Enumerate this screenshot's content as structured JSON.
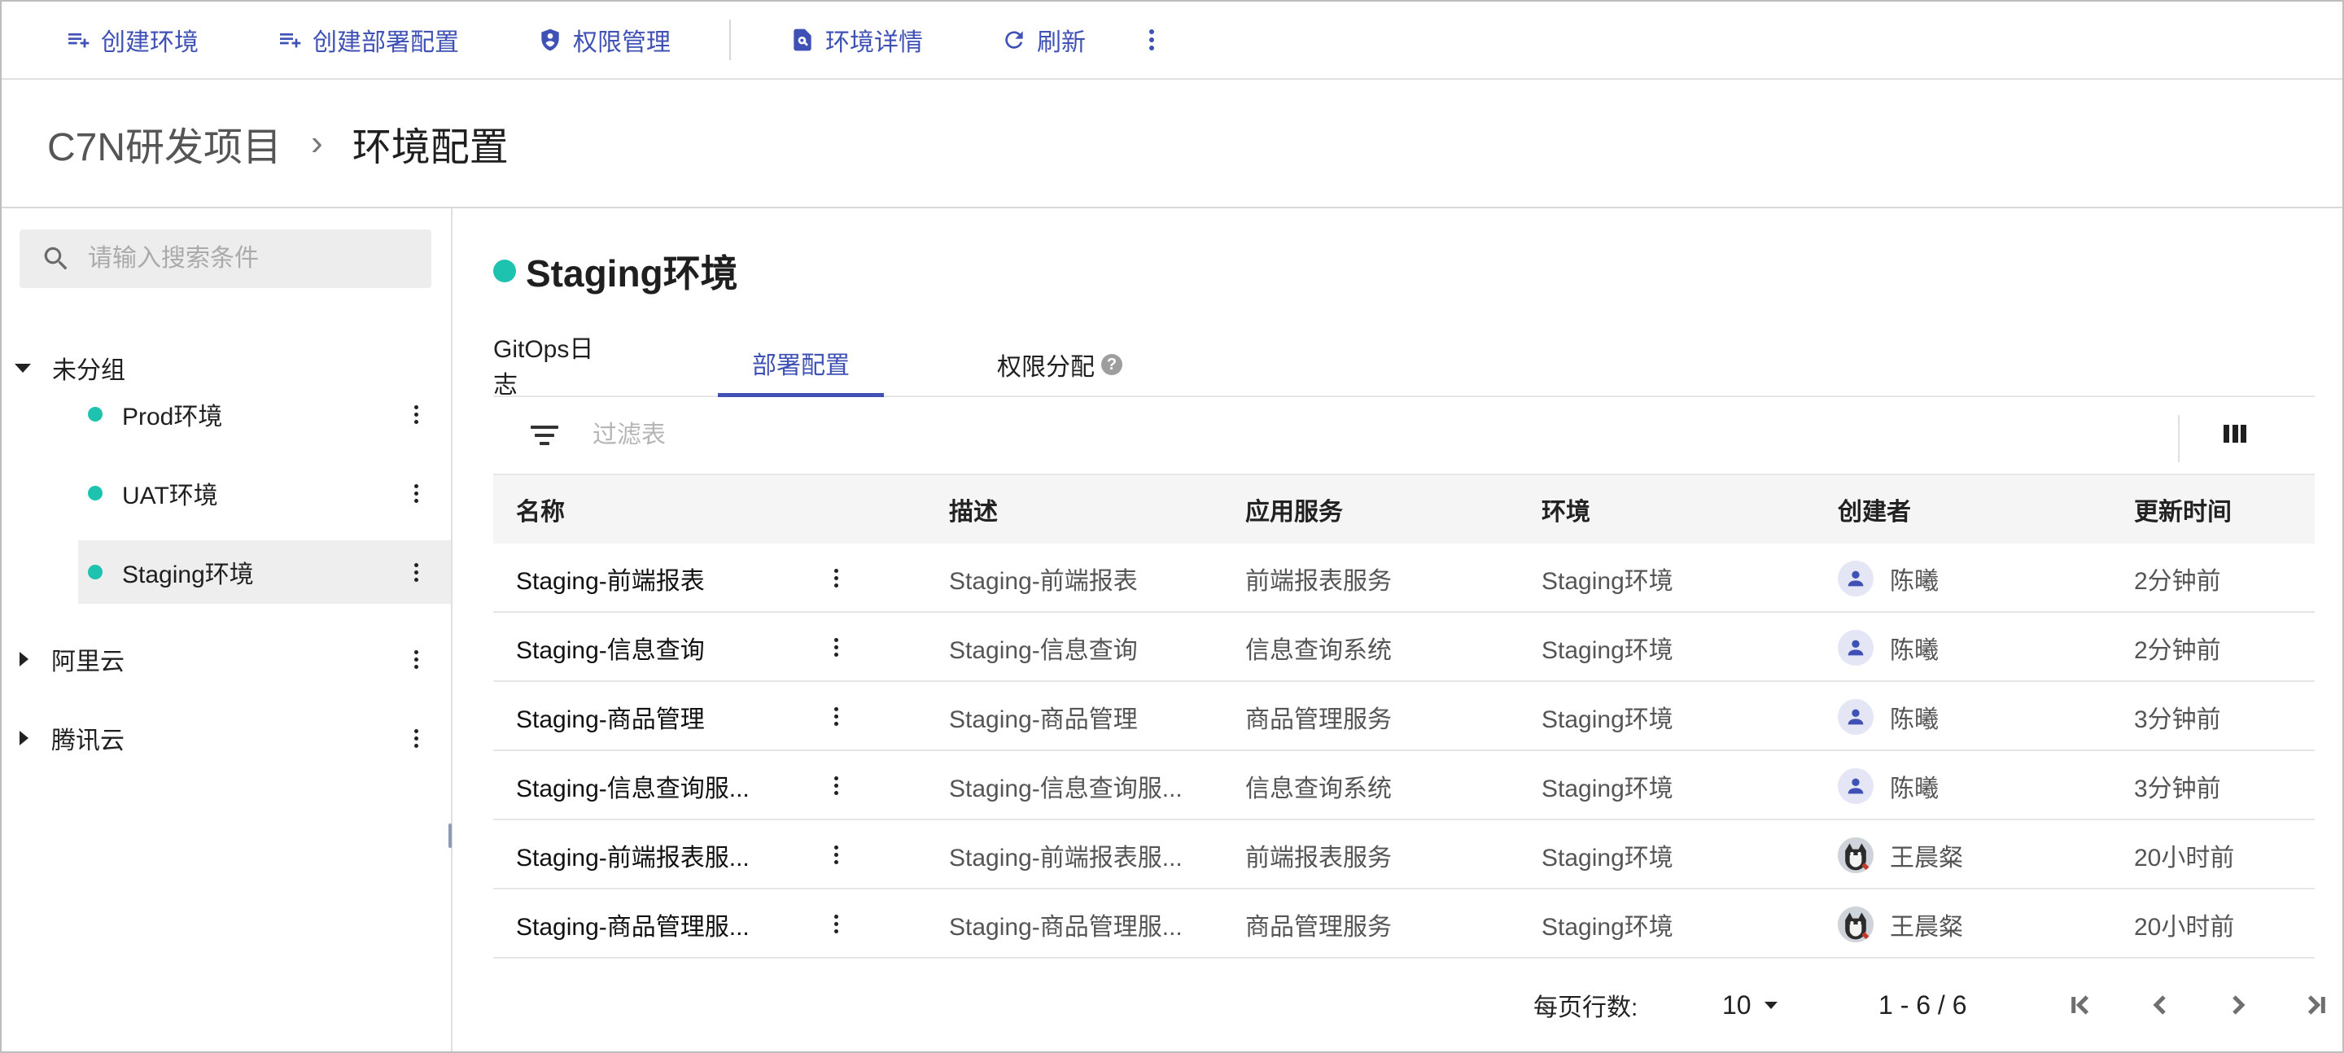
{
  "toolbar": {
    "create_env": "创建环境",
    "create_deploy_config": "创建部署配置",
    "permission_mgmt": "权限管理",
    "env_detail": "环境详情",
    "refresh": "刷新"
  },
  "breadcrumb": {
    "parent": "C7N研发项目",
    "separator": "›",
    "current": "环境配置"
  },
  "sidebar": {
    "search_placeholder": "请输入搜索条件",
    "groups": [
      {
        "label": "未分组",
        "expanded": true,
        "items": [
          {
            "label": "Prod环境",
            "status_color": "#1ec3b0"
          },
          {
            "label": "UAT环境",
            "status_color": "#1ec3b0"
          },
          {
            "label": "Staging环境",
            "status_color": "#1ec3b0",
            "selected": true
          }
        ]
      },
      {
        "label": "阿里云",
        "expanded": false
      },
      {
        "label": "腾讯云",
        "expanded": false
      }
    ]
  },
  "main": {
    "title": "Staging环境",
    "title_status_color": "#1ec3b0",
    "tabs": [
      {
        "label": "GitOps日志"
      },
      {
        "label": "部署配置",
        "active": true
      },
      {
        "label": "权限分配",
        "help": "?"
      }
    ],
    "filter_placeholder": "过滤表",
    "columns": [
      "名称",
      "描述",
      "应用服务",
      "环境",
      "创建者",
      "更新时间"
    ],
    "rows": [
      {
        "name": "Staging-前端报表",
        "desc": "Staging-前端报表",
        "service": "前端报表服务",
        "env": "Staging环境",
        "creator": "陈曦",
        "avatar": "default-avatar",
        "updated": "2分钟前"
      },
      {
        "name": "Staging-信息查询",
        "desc": "Staging-信息查询",
        "service": "信息查询系统",
        "env": "Staging环境",
        "creator": "陈曦",
        "avatar": "default-avatar",
        "updated": "2分钟前"
      },
      {
        "name": "Staging-商品管理",
        "desc": "Staging-商品管理",
        "service": "商品管理服务",
        "env": "Staging环境",
        "creator": "陈曦",
        "avatar": "default-avatar",
        "updated": "3分钟前"
      },
      {
        "name": "Staging-信息查询服...",
        "desc": "Staging-信息查询服...",
        "service": "信息查询系统",
        "env": "Staging环境",
        "creator": "陈曦",
        "avatar": "default-avatar",
        "updated": "3分钟前"
      },
      {
        "name": "Staging-前端报表服...",
        "desc": "Staging-前端报表服...",
        "service": "前端报表服务",
        "env": "Staging环境",
        "creator": "王晨粲",
        "avatar": "photo-avatar",
        "updated": "20小时前"
      },
      {
        "name": "Staging-商品管理服...",
        "desc": "Staging-商品管理服...",
        "service": "商品管理服务",
        "env": "Staging环境",
        "creator": "王晨粲",
        "avatar": "photo-avatar",
        "updated": "20小时前"
      }
    ],
    "pagination": {
      "rows_per_page_label": "每页行数:",
      "rows_per_page": "10",
      "range": "1 - 6 / 6"
    }
  },
  "colors": {
    "accent": "#3f51b5",
    "status_active": "#1ec3b0"
  }
}
